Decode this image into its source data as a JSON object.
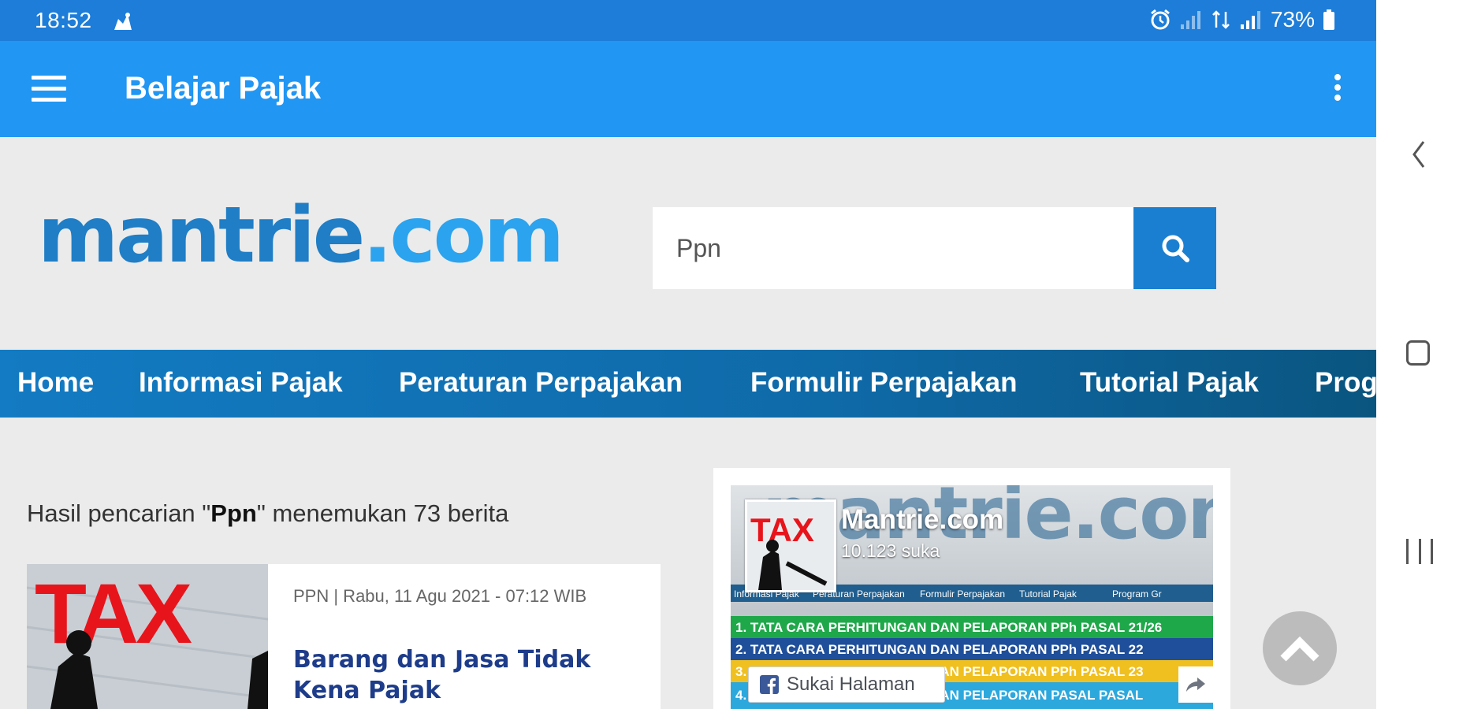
{
  "status_bar": {
    "time": "18:52",
    "battery": "73%",
    "icons": [
      "notification-icon",
      "alarm-icon",
      "signal-icon",
      "data-icon",
      "signal-icon",
      "battery-icon"
    ]
  },
  "app_bar": {
    "title": "Belajar Pajak",
    "menu_icon": "hamburger-icon",
    "overflow_icon": "more-vert-icon"
  },
  "header": {
    "logo_part1": "mantrie",
    "logo_part2": ".com",
    "search_value": "Ppn",
    "search_icon": "search-icon"
  },
  "menu": {
    "items": [
      "Home",
      "Informasi Pajak",
      "Peraturan Perpajakan",
      "Formulir Perpajakan",
      "Tutorial Pajak",
      "Prog"
    ]
  },
  "results": {
    "prefix": "Hasil pencarian \"",
    "query": "Ppn",
    "suffix": "\" menemukan 73 berita"
  },
  "article": {
    "meta": "PPN | Rabu, 11 Agu 2021 - 07:12 WIB",
    "title": "Barang dan Jasa Tidak Kena Pajak",
    "thumb_text": "TAX"
  },
  "fb_widget": {
    "cover_text": "mantrie.com",
    "avatar_text": "TAX",
    "page_name": "Mantrie.com",
    "likes": "10.123 suka",
    "nav_strip": [
      "Informasi Pajak",
      "Peraturan Perpajakan",
      "Formulir Perpajakan",
      "Tutorial Pajak",
      "Program Gr"
    ],
    "rows": [
      "1.  TATA CARA PERHITUNGAN DAN PELAPORAN PPh  PASAL 21/26",
      "2.  TATA CARA PERHITUNGAN DAN PELAPORAN PPh PASAL 22",
      "3.  TATA CARA PERHITUNGAN DAN PELAPORAN PPh PASAL 23",
      "4.  TATA CARA PERHITUNGAN DAN PELAPORAN PASAL PASAL"
    ],
    "like_button": "Sukai Halaman"
  },
  "colors": {
    "status_bar": "#1d7dd8",
    "app_bar": "#2196f3",
    "logo_dark": "#1f7ec6",
    "logo_light": "#2ba3ee",
    "nav": "#137bc3",
    "article_title": "#1d3c8a"
  }
}
